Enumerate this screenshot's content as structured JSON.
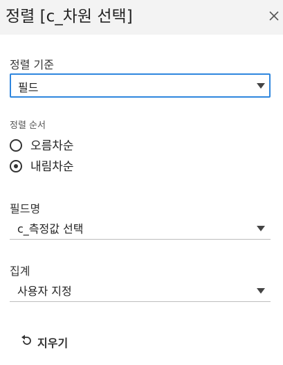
{
  "header": {
    "title": "정렬 [c_차원 선택]",
    "close_icon": "close-icon"
  },
  "sort_basis": {
    "label": "정렬 기준",
    "value": "필드"
  },
  "sort_order": {
    "label": "정렬 순서",
    "options": [
      {
        "label": "오름차순",
        "selected": false
      },
      {
        "label": "내림차순",
        "selected": true
      }
    ]
  },
  "field_name": {
    "label": "필드명",
    "value": "c_측정값 선택"
  },
  "aggregation": {
    "label": "집계",
    "value": "사용자 지정"
  },
  "clear": {
    "label": "지우기",
    "icon": "undo-icon"
  },
  "colors": {
    "header_bg": "#f3f3f3",
    "focus_border": "#2e86de"
  }
}
